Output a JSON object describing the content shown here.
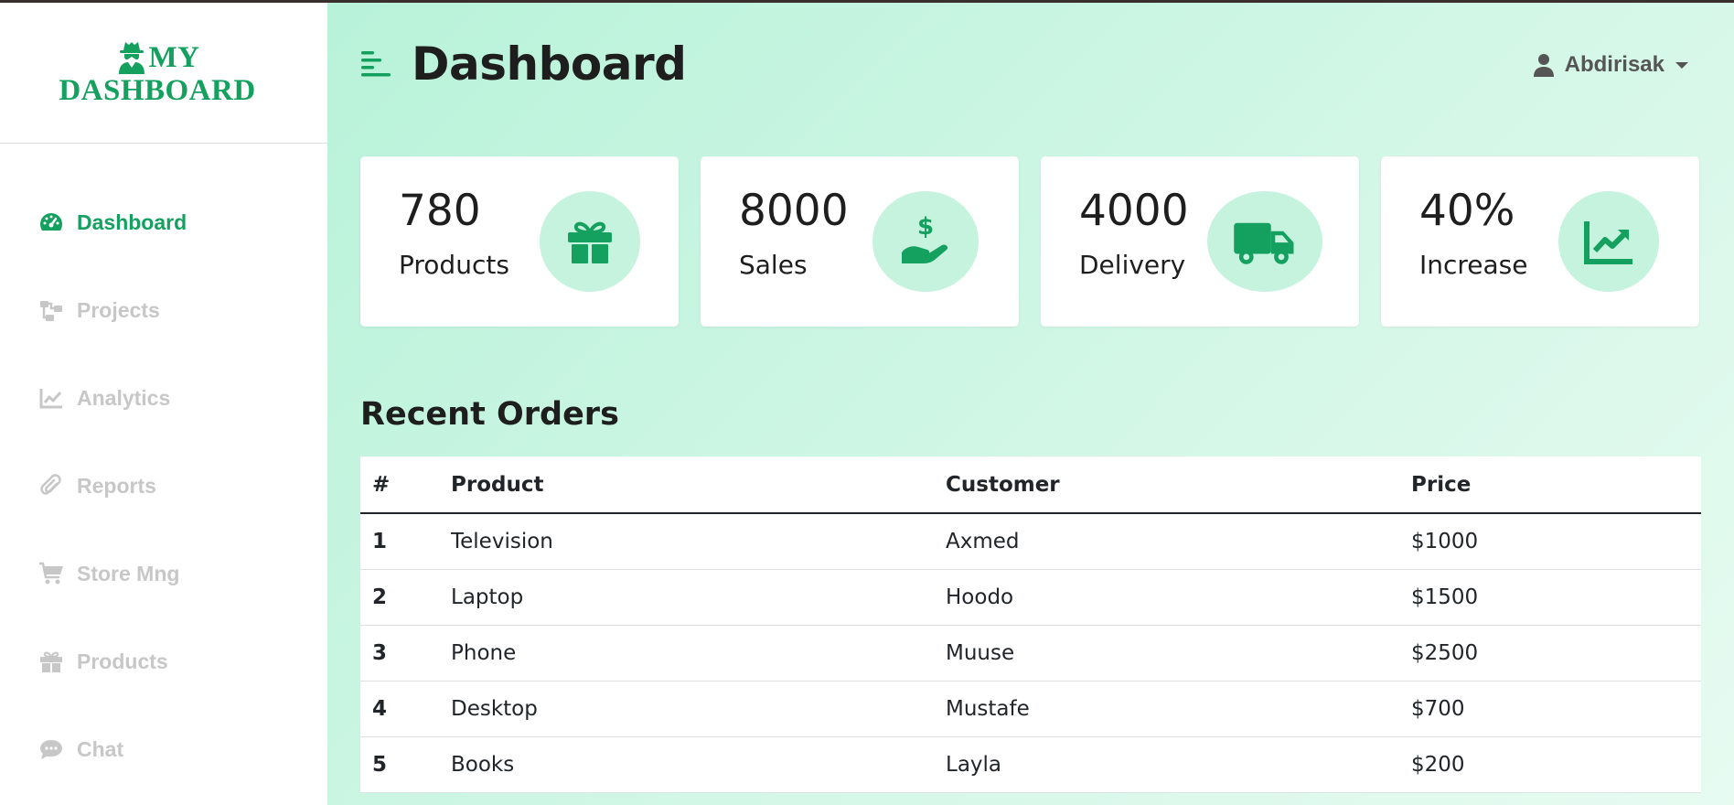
{
  "brand": {
    "line1": "MY",
    "line2": "DASHBOARD"
  },
  "nav": [
    {
      "label": "Dashboard",
      "icon": "gauge-icon",
      "active": true
    },
    {
      "label": "Projects",
      "icon": "sitemap-icon"
    },
    {
      "label": "Analytics",
      "icon": "chart-line-icon"
    },
    {
      "label": "Reports",
      "icon": "paperclip-icon"
    },
    {
      "label": "Store Mng",
      "icon": "cart-icon"
    },
    {
      "label": "Products",
      "icon": "gift-icon"
    },
    {
      "label": "Chat",
      "icon": "chat-icon"
    }
  ],
  "header": {
    "title": "Dashboard",
    "user": "Abdirisak"
  },
  "cards": [
    {
      "value": "780",
      "label": "Products",
      "icon": "gift-icon"
    },
    {
      "value": "8000",
      "label": "Sales",
      "icon": "hand-dollar-icon"
    },
    {
      "value": "4000",
      "label": "Delivery",
      "icon": "truck-icon"
    },
    {
      "value": "40%",
      "label": "Increase",
      "icon": "chart-increase-icon"
    }
  ],
  "orders": {
    "title": "Recent Orders",
    "columns": [
      "#",
      "Product",
      "Customer",
      "Price"
    ],
    "rows": [
      [
        "1",
        "Television",
        "Axmed",
        "$1000"
      ],
      [
        "2",
        "Laptop",
        "Hoodo",
        "$1500"
      ],
      [
        "3",
        "Phone",
        "Muuse",
        "$2500"
      ],
      [
        "4",
        "Desktop",
        "Mustafe",
        "$700"
      ],
      [
        "5",
        "Books",
        "Layla",
        "$200"
      ]
    ]
  },
  "colors": {
    "accent": "#14a05f",
    "muted": "#c7c7c7",
    "circle": "#c6f3de"
  }
}
